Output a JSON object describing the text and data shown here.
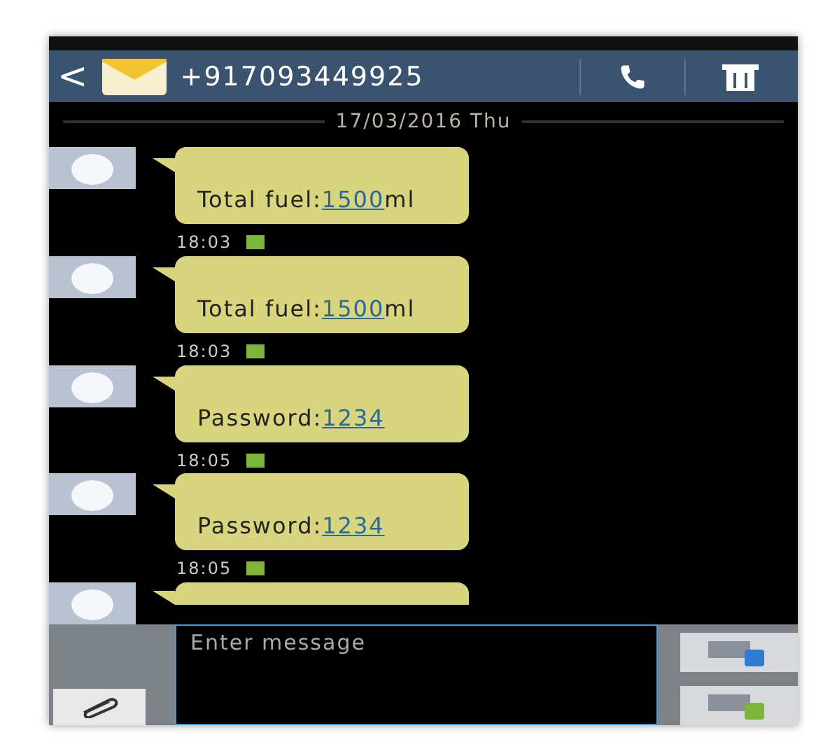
{
  "header": {
    "back": "<",
    "contact": "+917093449925"
  },
  "date": "17/03/2016 Thu",
  "messages": [
    {
      "label": "Total fuel:",
      "value": "1500",
      "unit": "ml",
      "time": "18:03"
    },
    {
      "label": "Total fuel:",
      "value": "1500",
      "unit": "ml",
      "time": "18:03"
    },
    {
      "label": "Password:",
      "value": "1234",
      "time": "18:05"
    },
    {
      "label": "Password:",
      "value": "1234",
      "time": "18:05"
    }
  ],
  "composer": {
    "placeholder": "Enter message"
  }
}
